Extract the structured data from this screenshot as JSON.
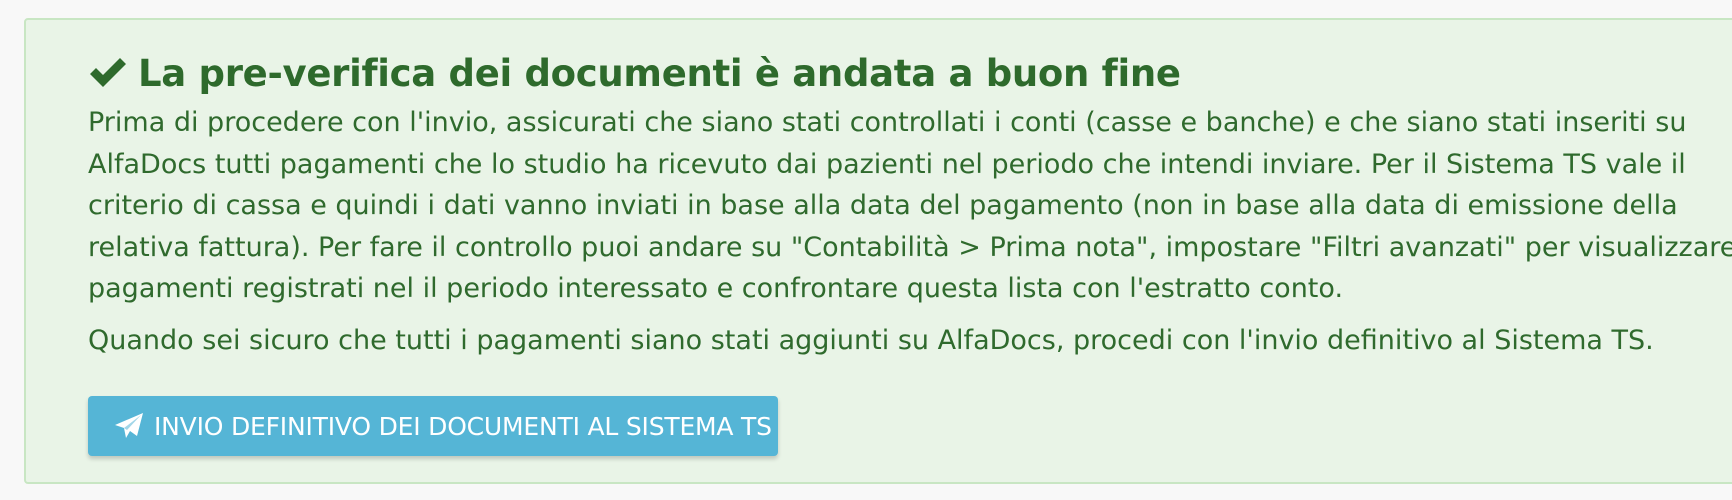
{
  "alert": {
    "icon": "check-icon",
    "title": "La pre-verifica dei documenti è andata a buon fine",
    "paragraph1_lines": [
      "Prima di procedere con l'invio, assicurati che siano stati controllati i conti (casse e banche) e che siano stati inseriti su",
      "AlfaDocs tutti pagamenti che lo studio ha ricevuto dai pazienti nel periodo che intendi inviare. Per il Sistema TS vale il",
      "criterio di cassa e quindi i dati vanno inviati in base alla data del pagamento (non in base alla data di emissione della",
      "relativa fattura). Per fare il controllo puoi andare su \"Contabilità > Prima nota\", impostare \"Filtri avanzati\" per visualizzare i",
      "pagamenti registrati nel il periodo interessato e confrontare questa lista con l'estratto conto."
    ],
    "paragraph2": "Quando sei sicuro che tutti i pagamenti siano stati aggiunti su AlfaDocs, procedi con l'invio definitivo al Sistema TS.",
    "button": {
      "icon": "paper-plane-icon",
      "label": "INVIO DEFINITIVO DEI DOCUMENTI AL SISTEMA TS"
    }
  },
  "colors": {
    "alert_background": "#e9f4e7",
    "alert_border": "#c8e6c3",
    "alert_text": "#2e6a2c",
    "button_background": "#55b5d6",
    "button_text": "#ffffff"
  }
}
